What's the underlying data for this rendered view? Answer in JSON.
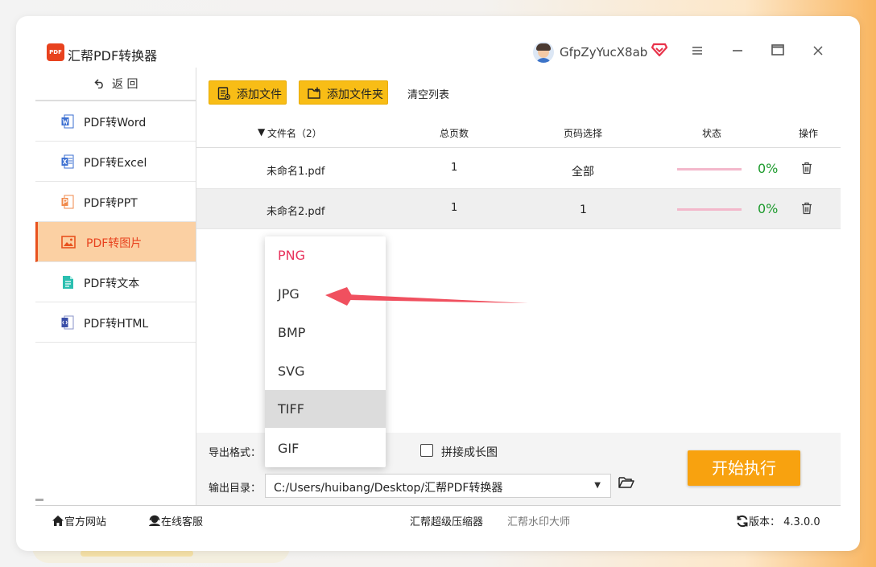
{
  "window": {
    "app_title": "汇帮PDF转换器",
    "app_logo_text": "PDF",
    "username": "GfpZyYucX8ab"
  },
  "sidebar": {
    "back_label": "返  回",
    "items": [
      {
        "label": "PDF转Word",
        "icon": "word-icon",
        "color": "#3b6fd1"
      },
      {
        "label": "PDF转Excel",
        "icon": "excel-icon",
        "color": "#3b6fd1"
      },
      {
        "label": "PDF转PPT",
        "icon": "ppt-icon",
        "color": "#f08a4b"
      },
      {
        "label": "PDF转图片",
        "icon": "image-icon",
        "color": "#e8521e",
        "active": true
      },
      {
        "label": "PDF转文本",
        "icon": "text-icon",
        "color": "#2bbfb0"
      },
      {
        "label": "PDF转HTML",
        "icon": "html-icon",
        "color": "#3b4fa8"
      }
    ]
  },
  "toolbar": {
    "add_file": "添加文件",
    "add_folder": "添加文件夹",
    "clear_list": "清空列表"
  },
  "table": {
    "headers": {
      "name": "文件名（2）",
      "pages": "总页数",
      "page_select": "页码选择",
      "status": "状态",
      "action": "操作"
    },
    "rows": [
      {
        "name": "未命名1.pdf",
        "pages": "1",
        "page_select": "全部",
        "progress": "0%"
      },
      {
        "name": "未命名2.pdf",
        "pages": "1",
        "page_select": "1",
        "progress": "0%"
      }
    ]
  },
  "format_dropdown": {
    "options": [
      "PNG",
      "JPG",
      "BMP",
      "SVG",
      "TIFF",
      "GIF"
    ],
    "selected": "PNG",
    "hovered": "TIFF"
  },
  "bottom": {
    "format_label": "导出格式：",
    "merge_label": "拼接成长图",
    "output_label": "输出目录：",
    "output_dir": "C:/Users/huibang/Desktop/汇帮PDF转换器",
    "start_button": "开始执行"
  },
  "footer": {
    "website": "官方网站",
    "support": "在线客服",
    "compressor": "汇帮超级压缩器",
    "watermark": "汇帮水印大师",
    "version_label": "版本：",
    "version": "4.3.0.0"
  },
  "colors": {
    "accent": "#f8bd16",
    "start": "#f8a20f",
    "active_bg": "#fbd0a3",
    "active_text": "#e8421e",
    "progress_text": "#1e9b2e",
    "arrow": "#f0505f"
  }
}
